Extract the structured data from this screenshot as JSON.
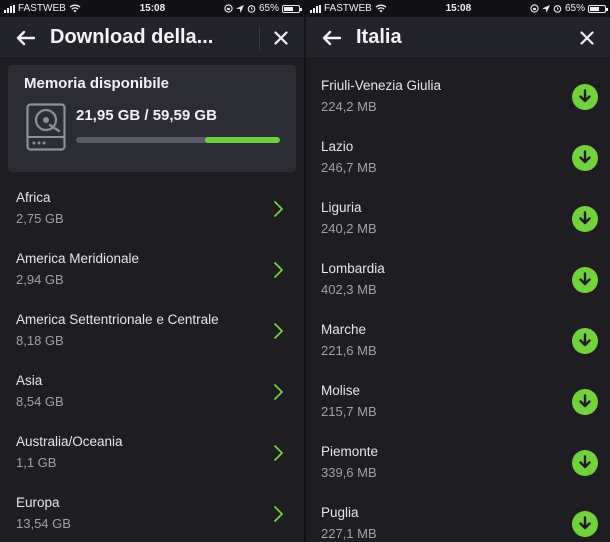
{
  "status": {
    "carrier": "FASTWEB",
    "time": "15:08",
    "battery": "65%"
  },
  "left": {
    "title": "Download della...",
    "storage": {
      "label": "Memoria disponibile",
      "value": "21,95 GB / 59,59 GB",
      "free_fraction": 0.368
    },
    "items": [
      {
        "name": "Africa",
        "size": "2,75 GB"
      },
      {
        "name": "America Meridionale",
        "size": "2,94 GB"
      },
      {
        "name": "America Settentrionale e Centrale",
        "size": "8,18 GB"
      },
      {
        "name": "Asia",
        "size": "8,54 GB"
      },
      {
        "name": "Australia/Oceania",
        "size": "1,1 GB"
      },
      {
        "name": "Europa",
        "size": "13,54 GB"
      }
    ]
  },
  "right": {
    "title": "Italia",
    "items": [
      {
        "name": "Friuli-Venezia Giulia",
        "size": "224,2 MB"
      },
      {
        "name": "Lazio",
        "size": "246,7 MB"
      },
      {
        "name": "Liguria",
        "size": "240,2 MB"
      },
      {
        "name": "Lombardia",
        "size": "402,3 MB"
      },
      {
        "name": "Marche",
        "size": "221,6 MB"
      },
      {
        "name": "Molise",
        "size": "215,7 MB"
      },
      {
        "name": "Piemonte",
        "size": "339,6 MB"
      },
      {
        "name": "Puglia",
        "size": "227,1 MB"
      }
    ]
  },
  "colors": {
    "accent": "#74d13e",
    "background": "#1d1d22",
    "card": "#2c2c35"
  },
  "icons": [
    "back-arrow-icon",
    "close-icon",
    "hard-drive-icon",
    "chevron-right-icon",
    "download-icon",
    "wifi-icon",
    "battery-icon"
  ]
}
